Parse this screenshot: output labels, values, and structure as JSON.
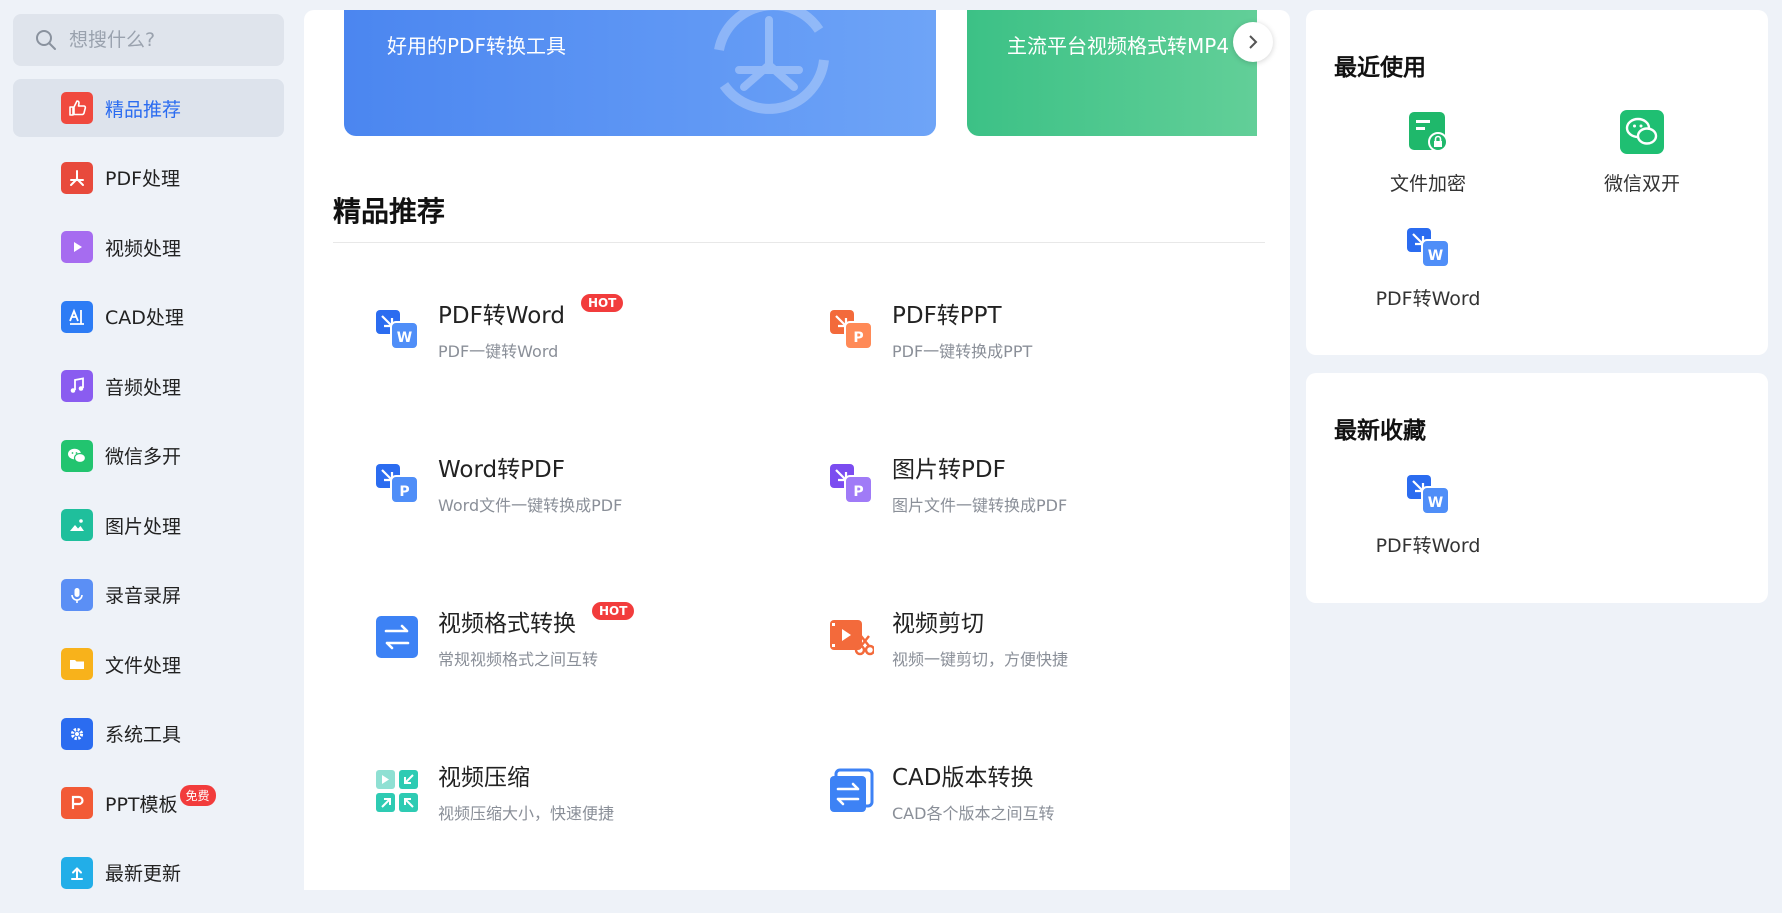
{
  "search": {
    "placeholder": "想搜什么?"
  },
  "sidebar": {
    "items": [
      {
        "label": "精品推荐",
        "icon": "thumbs-up-icon",
        "color": "#f0493e",
        "active": true
      },
      {
        "label": "PDF处理",
        "icon": "pdf-icon",
        "color": "#e84a3c"
      },
      {
        "label": "视频处理",
        "icon": "play-icon",
        "color": "#a66cf0"
      },
      {
        "label": "CAD处理",
        "icon": "cad-icon",
        "color": "#2d7cf5"
      },
      {
        "label": "音频处理",
        "icon": "music-icon",
        "color": "#8a5cf0"
      },
      {
        "label": "微信多开",
        "icon": "wechat-icon",
        "color": "#22c46f"
      },
      {
        "label": "图片处理",
        "icon": "image-icon",
        "color": "#1fbf9c"
      },
      {
        "label": "录音录屏",
        "icon": "microphone-icon",
        "color": "#5b8ff5"
      },
      {
        "label": "文件处理",
        "icon": "folder-icon",
        "color": "#f8b21b"
      },
      {
        "label": "系统工具",
        "icon": "gear-icon",
        "color": "#2b6cf0"
      },
      {
        "label": "PPT模板",
        "icon": "ppt-icon",
        "color": "#f25a36",
        "badge": "免费"
      },
      {
        "label": "最新更新",
        "icon": "upload-icon",
        "color": "#22aee8"
      }
    ]
  },
  "banners": [
    {
      "text": "好用的PDF转换工具",
      "color": "#4b86f0"
    },
    {
      "text": "主流平台视频格式转MP4",
      "color": "#3cc186"
    }
  ],
  "main": {
    "section_title": "精品推荐",
    "tools": [
      {
        "title": "PDF转Word",
        "desc": "PDF一键转Word",
        "badge": "HOT",
        "icon": "pdf-to-word-icon"
      },
      {
        "title": "PDF转PPT",
        "desc": "PDF一键转换成PPT",
        "icon": "pdf-to-ppt-icon"
      },
      {
        "title": "Word转PDF",
        "desc": "Word文件一键转换成PDF",
        "icon": "word-to-pdf-icon"
      },
      {
        "title": "图片转PDF",
        "desc": "图片文件一键转换成PDF",
        "icon": "image-to-pdf-icon"
      },
      {
        "title": "视频格式转换",
        "desc": "常规视频格式之间互转",
        "badge": "HOT",
        "icon": "video-convert-icon"
      },
      {
        "title": "视频剪切",
        "desc": "视频一键剪切，方便快捷",
        "icon": "video-cut-icon"
      },
      {
        "title": "视频压缩",
        "desc": "视频压缩大小，快速便捷",
        "icon": "video-compress-icon"
      },
      {
        "title": "CAD版本转换",
        "desc": "CAD各个版本之间互转",
        "icon": "cad-convert-icon"
      }
    ]
  },
  "recent": {
    "title": "最近使用",
    "apps": [
      {
        "label": "文件加密",
        "icon": "file-encrypt-icon"
      },
      {
        "label": "微信双开",
        "icon": "wechat-icon"
      },
      {
        "label": "PDF转Word",
        "icon": "pdf-to-word-icon"
      }
    ]
  },
  "favorites": {
    "title": "最新收藏",
    "apps": [
      {
        "label": "PDF转Word",
        "icon": "pdf-to-word-icon"
      }
    ]
  }
}
